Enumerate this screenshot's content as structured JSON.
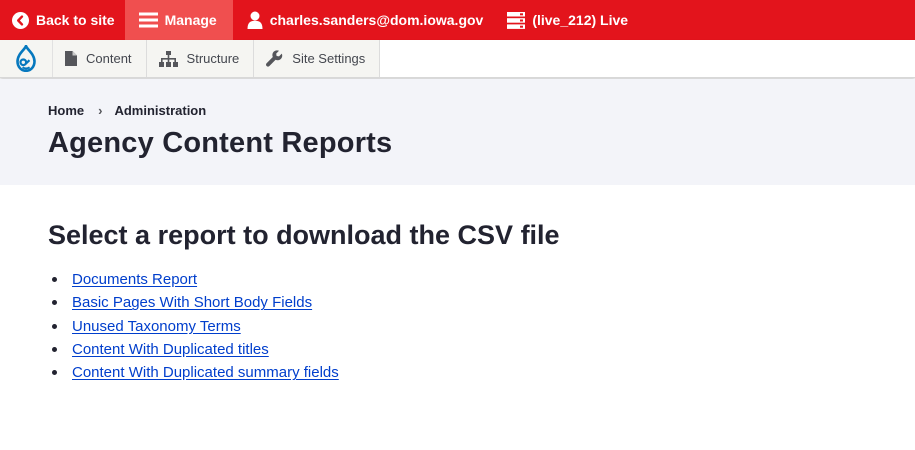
{
  "toolbar": {
    "back_label": "Back to site",
    "manage_label": "Manage",
    "user_label": "charles.sanders@dom.iowa.gov",
    "env_label": "(live_212) Live"
  },
  "tray": {
    "items": [
      {
        "label": "Content",
        "icon": "file-icon"
      },
      {
        "label": "Structure",
        "icon": "structure-icon"
      },
      {
        "label": "Site Settings",
        "icon": "wrench-icon"
      }
    ]
  },
  "breadcrumb": [
    "Home",
    "Administration"
  ],
  "page": {
    "title": "Agency Content Reports",
    "heading": "Select a report to download the CSV file"
  },
  "reports": [
    "Documents Report",
    "Basic Pages With Short Body Fields",
    "Unused Taxonomy Terms",
    "Content With Duplicated titles",
    "Content With Duplicated summary fields"
  ],
  "colors": {
    "toolbar_red": "#e3141c",
    "manage_active": "#f04f4f",
    "link_blue": "#003ecc",
    "header_bg": "#f3f4f9"
  }
}
